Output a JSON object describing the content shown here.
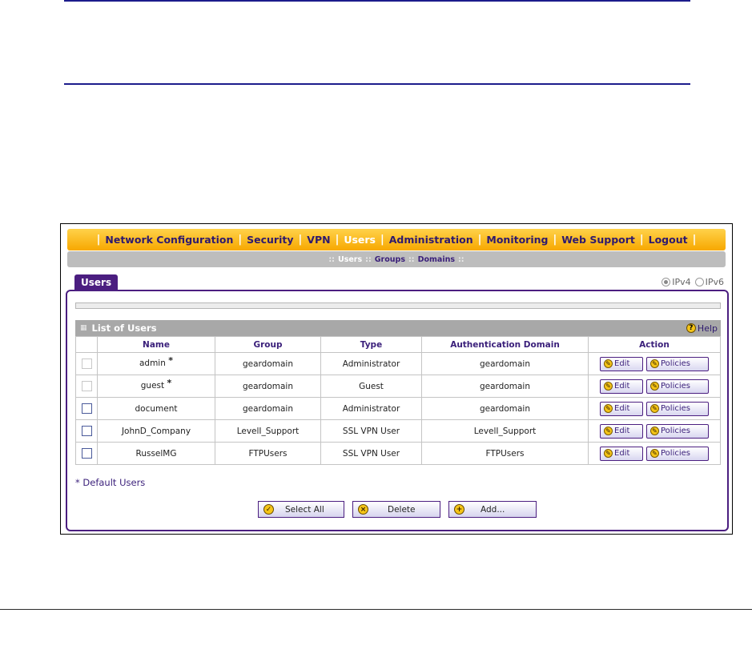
{
  "nav": {
    "items": [
      {
        "label": "Network Configuration",
        "active": false
      },
      {
        "label": "Security",
        "active": false
      },
      {
        "label": "VPN",
        "active": false
      },
      {
        "label": "Users",
        "active": true
      },
      {
        "label": "Administration",
        "active": false
      },
      {
        "label": "Monitoring",
        "active": false
      },
      {
        "label": "Web Support",
        "active": false
      },
      {
        "label": "Logout",
        "active": false
      }
    ],
    "separator": "|"
  },
  "subnav": {
    "items": [
      {
        "label": "Users",
        "active": true
      },
      {
        "label": "Groups",
        "active": false
      },
      {
        "label": "Domains",
        "active": false
      }
    ],
    "separator": "::"
  },
  "tab": {
    "label": "Users"
  },
  "ip_version": {
    "ipv4": "IPv4",
    "ipv6": "IPv6",
    "selected": "IPv4"
  },
  "list": {
    "title": "List of Users",
    "help": "Help",
    "columns": [
      "Name",
      "Group",
      "Type",
      "Authentication Domain",
      "Action"
    ],
    "rows": [
      {
        "name": "admin",
        "default": true,
        "group": "geardomain",
        "type": "Administrator",
        "domain": "geardomain"
      },
      {
        "name": "guest",
        "default": true,
        "group": "geardomain",
        "type": "Guest",
        "domain": "geardomain"
      },
      {
        "name": "document",
        "default": false,
        "group": "geardomain",
        "type": "Administrator",
        "domain": "geardomain"
      },
      {
        "name": "JohnD_Company",
        "default": false,
        "group": "LevelI_Support",
        "type": "SSL VPN User",
        "domain": "LevelI_Support"
      },
      {
        "name": "RusselMG",
        "default": false,
        "group": "FTPUsers",
        "type": "SSL VPN User",
        "domain": "FTPUsers"
      }
    ],
    "edit_label": "Edit",
    "policies_label": "Policies",
    "default_star": "*"
  },
  "default_note": "* Default Users",
  "buttons": {
    "select_all": "Select All",
    "delete": "Delete",
    "add": "Add..."
  },
  "colors": {
    "nav_bar": "#f7a800",
    "accent": "#4b1e80",
    "subnav": "#bdbdbd",
    "list_header": "#a8a8a8"
  }
}
